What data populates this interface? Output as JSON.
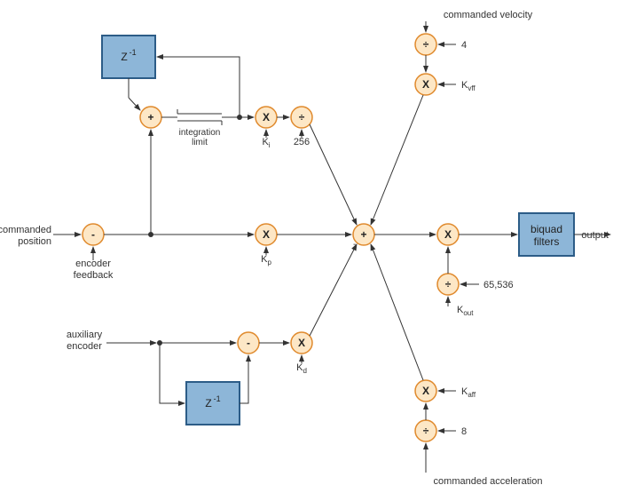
{
  "diagram": {
    "type": "control-block-diagram",
    "inputs": {
      "commanded_velocity": "commanded velocity",
      "commanded_position": "commanded\nposition",
      "encoder_feedback": "encoder\nfeedback",
      "auxiliary_encoder": "auxiliary\nencoder",
      "commanded_acceleration": "commanded acceleration"
    },
    "output_label": "output",
    "blocks": {
      "delay1": "Z",
      "delay1_exp": "-1",
      "delay2": "Z",
      "delay2_exp": "-1",
      "biquad": "biquad\nfilters",
      "integration_limit": "integration\nlimit"
    },
    "gains": {
      "ki": "K",
      "ki_sub": "i",
      "kp": "K",
      "kp_sub": "p",
      "kd": "K",
      "kd_sub": "d",
      "kvff": "K",
      "kvff_sub": "vff",
      "kaff": "K",
      "kaff_sub": "aff",
      "kout": "K",
      "kout_sub": "out"
    },
    "constants": {
      "four": "4",
      "eight": "8",
      "div256": "256",
      "div65536": "65,536"
    },
    "ops": {
      "plus": "+",
      "minus": "-",
      "minus_super": "-",
      "mult": "X",
      "div": "÷"
    }
  }
}
